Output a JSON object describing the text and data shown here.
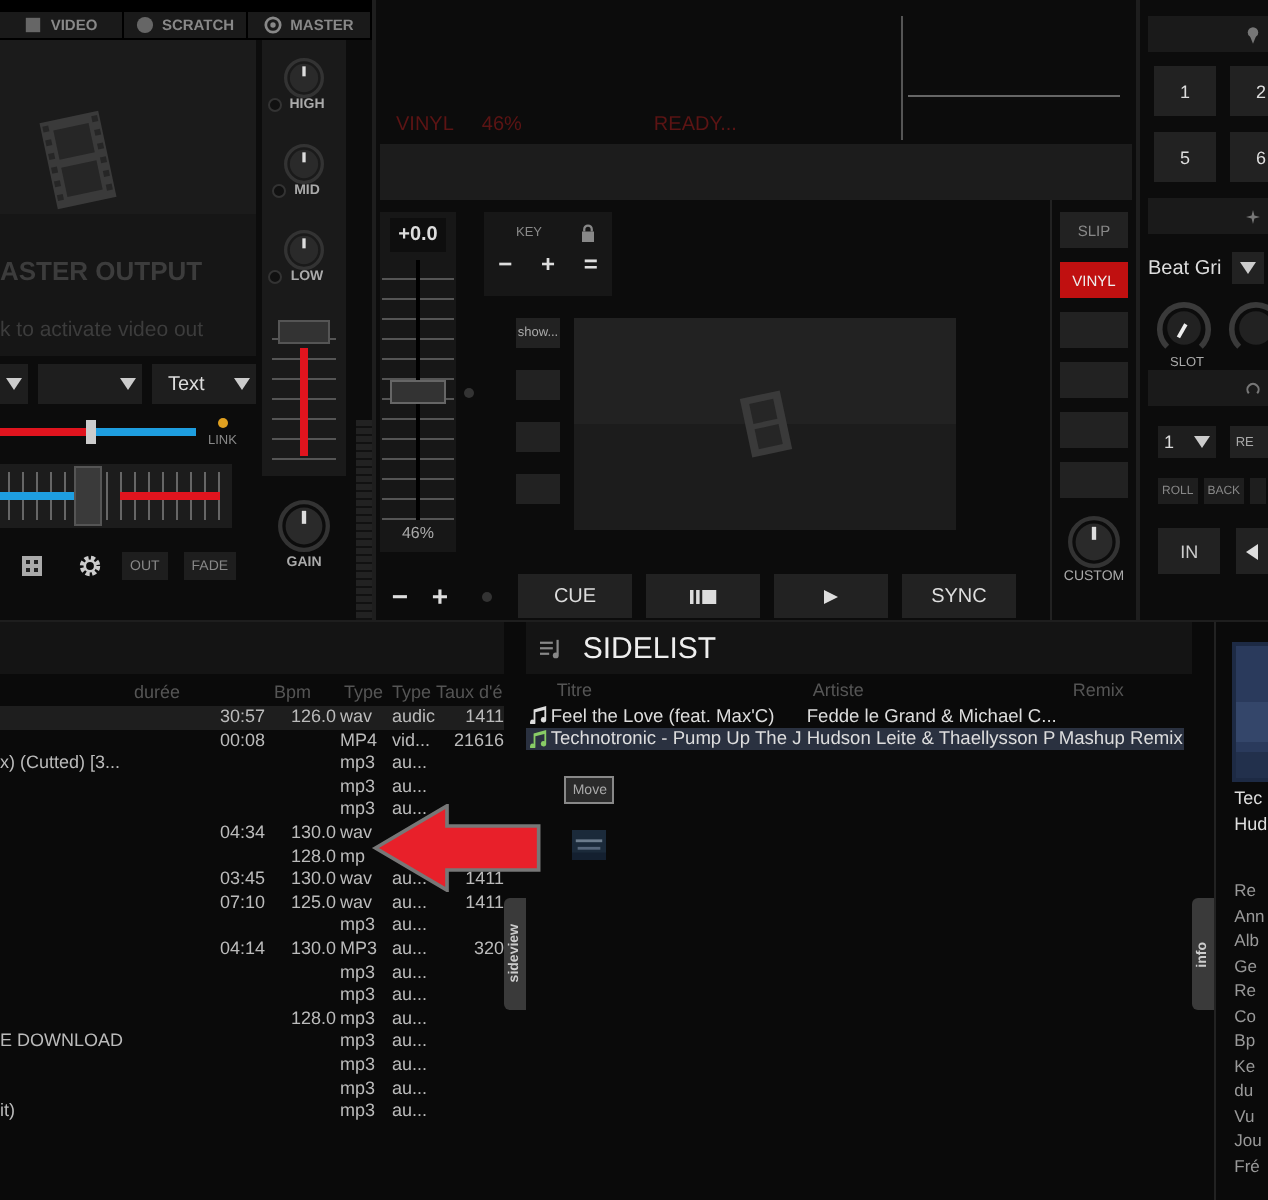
{
  "mixer": {
    "tabs": [
      {
        "label": "VIDEO",
        "selected": false
      },
      {
        "label": "SCRATCH",
        "selected": false
      },
      {
        "label": "MASTER",
        "selected": false
      }
    ],
    "video": {
      "title": "ASTER OUTPUT",
      "hint": "k to activate video out"
    },
    "eq": [
      "HIGH",
      "MID",
      "LOW"
    ],
    "gain_label": "GAIN",
    "text_select": "Text",
    "crossfader": {
      "level": 0.46
    },
    "link": {
      "label": "LINK",
      "on": true
    },
    "fader": {
      "level": 0.38
    },
    "buttons": [
      "OUT",
      "FADE"
    ]
  },
  "deck": {
    "status": [
      "VINYL",
      "46%",
      "READY..."
    ],
    "pitch": {
      "value": "+0.0",
      "percent": "46%",
      "level": 0.5
    },
    "key_label": "KEY",
    "key_buttons": [
      "−",
      "+",
      "="
    ],
    "pitch_buttons": [
      "−",
      "+"
    ],
    "show_button": "show...",
    "transport": [
      {
        "kind": "text",
        "label": "CUE"
      },
      {
        "kind": "pause-stop"
      },
      {
        "kind": "play"
      },
      {
        "kind": "text",
        "label": "SYNC"
      }
    ],
    "modes": [
      {
        "label": "SLIP",
        "on": false
      },
      {
        "label": "VINYL",
        "on": true
      }
    ],
    "custom_label": "CUSTOM"
  },
  "side_panel": {
    "pads": [
      "1",
      "2",
      "5",
      "6"
    ],
    "effect": "Beat Gri",
    "slot_label": "SLOT",
    "loop_size": "1",
    "loop_button": "RE",
    "loop_modes": [
      "ROLL",
      "BACK"
    ],
    "in_label": "IN"
  },
  "browser": {
    "columns": [
      "durée",
      "Bpm",
      "Type",
      "Type",
      "Taux d'é"
    ],
    "rows": [
      {
        "selected": true,
        "time": "30:57",
        "bpm": "126.0",
        "type": "wav",
        "type_2": "audic",
        "rate": "1411"
      },
      {
        "selected": false,
        "time": "00:08",
        "type": "MP4",
        "type_2": "vid...",
        "rate": "21616"
      },
      {
        "selected": false,
        "title": "x) (Cutted) [3...",
        "type": "mp3",
        "type_2": "au..."
      },
      {
        "selected": false,
        "type": "mp3",
        "type_2": "au..."
      },
      {
        "selected": false,
        "type": "mp3",
        "type_2": "au..."
      },
      {
        "selected": false,
        "time": "04:34",
        "bpm": "130.0",
        "type": "wav"
      },
      {
        "selected": false,
        "bpm": "128.0",
        "type": "mp"
      },
      {
        "selected": false,
        "time": "03:45",
        "bpm": "130.0",
        "type": "wav",
        "type_2": "au...",
        "rate": "1411"
      },
      {
        "selected": false,
        "time": "07:10",
        "bpm": "125.0",
        "type": "wav",
        "type_2": "au...",
        "rate": "1411"
      },
      {
        "selected": false,
        "type": "mp3",
        "type_2": "au..."
      },
      {
        "selected": false,
        "time": "04:14",
        "bpm": "130.0",
        "type": "MP3",
        "type_2": "au...",
        "rate": "320"
      },
      {
        "selected": false,
        "type": "mp3",
        "type_2": "au..."
      },
      {
        "selected": false,
        "type": "mp3",
        "type_2": "au..."
      },
      {
        "selected": false,
        "bpm": "128.0",
        "type": "mp3",
        "type_2": "au..."
      },
      {
        "selected": false,
        "title": "E DOWNLOAD",
        "type": "mp3",
        "type_2": "au..."
      },
      {
        "selected": false,
        "type": "mp3",
        "type_2": "au..."
      },
      {
        "selected": false,
        "type": "mp3",
        "type_2": "au..."
      },
      {
        "selected": false,
        "title": "it)",
        "type": "mp3",
        "type_2": "au..."
      }
    ],
    "tab": "sideview"
  },
  "sidelist": {
    "title": "SIDELIST",
    "columns": [
      "Titre",
      "Artiste",
      "Remix"
    ],
    "rows": [
      {
        "selected": false,
        "title": "Feel the Love (feat. Max'C)",
        "artist": "Fedde le Grand & Michael C..."
      },
      {
        "selected": true,
        "title": "Technotronic - Pump Up The J",
        "artist": "Hudson Leite & Thaellysson P",
        "remix": "Mashup Remix"
      }
    ],
    "move_button": "Move",
    "tab": "info"
  },
  "info": {
    "title": "Tec",
    "artist": "Hud",
    "fields": [
      "Re",
      "Ann",
      "Alb",
      "Ge",
      "Re",
      "Co",
      "Bp",
      "Ke",
      "du",
      "Vu",
      "Jou",
      "Fré"
    ]
  }
}
